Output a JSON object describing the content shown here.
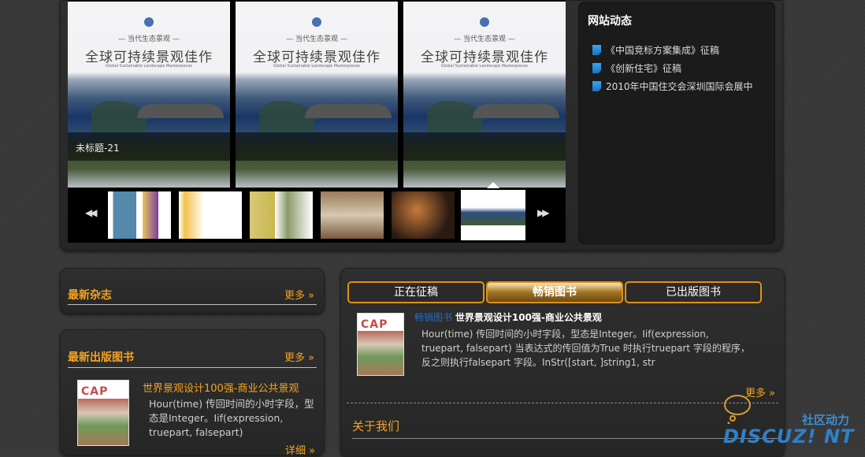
{
  "slider": {
    "slides": [
      {
        "subtitle": "— 当代生态景观 —",
        "title": "全球可持续景观佳作",
        "en": "Global Sustainable Landscape Masterpieces"
      },
      {
        "subtitle": "— 当代生态景观 —",
        "title": "全球可持续景观佳作",
        "en": "Global Sustainable Landscape Masterpieces"
      },
      {
        "subtitle": "— 当代生态景观 —",
        "title": "全球可持续景观佳作",
        "en": "Global Sustainable Landscape Masterpieces"
      }
    ],
    "caption": "未标题-21",
    "prev_label": "◀◀",
    "next_label": "▶▶"
  },
  "news": {
    "title": "网站动态",
    "items": [
      "《中国竞标方案集成》征稿",
      "《创新住宅》征稿",
      "2010年中国住交会深圳国际会展中"
    ]
  },
  "magazines": {
    "title": "最新杂志",
    "more": "更多 »"
  },
  "books": {
    "title": "最新出版图书",
    "more": "更多 »",
    "book_title": "世界景观设计100强-商业公共景观",
    "desc": "Hour(time) 传回时间的小时字段，型态是Integer。Iif(expression, truepart, falsepart)",
    "cover": "CAP",
    "detail": "详细 »"
  },
  "tabs": [
    "正在征稿",
    "畅销图书",
    "已出版图书"
  ],
  "bestseller": {
    "tag": "畅销图书",
    "title": "世界景观设计100强-商业公共景观",
    "desc": "Hour(time) 传回时间的小时字段，型态是Integer。Iif(expression, truepart, falsepart) 当表达式的传回值为True 时执行truepart 字段的程序，反之则执行falsepart 字段。InStr([start, ]string1, str",
    "more": "更多 »",
    "cover": "CAP"
  },
  "about": {
    "title": "关于我们"
  },
  "watermark": {
    "line1": "社区动力",
    "line2": "DISCUZ! NT"
  },
  "colors": {
    "accent": "#f3a423",
    "tab_border": "#e08f16",
    "link": "#1e6fc4"
  }
}
